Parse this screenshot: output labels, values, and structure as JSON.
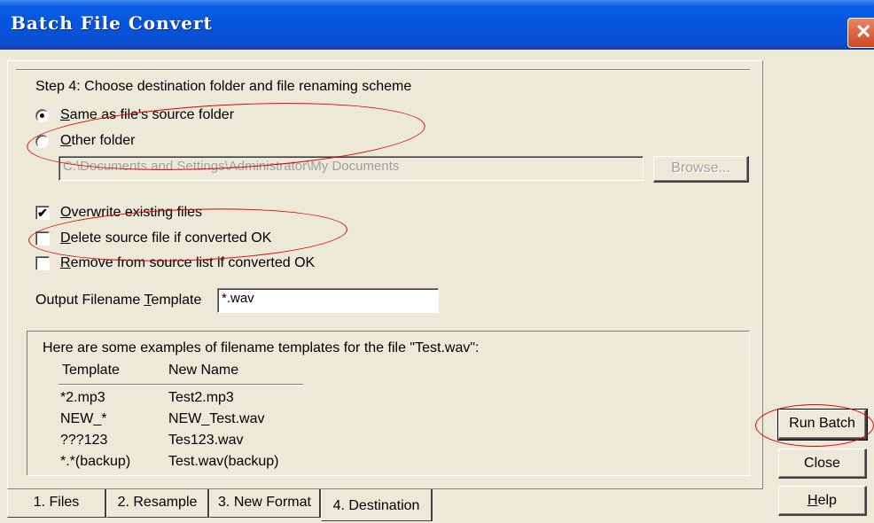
{
  "window": {
    "title": "Batch File Convert",
    "close_symbol": "✕"
  },
  "step_heading": "Step 4:  Choose destination folder and file renaming scheme",
  "folder_options": [
    {
      "label_access": "S",
      "label_rest": "ame as file's source folder",
      "selected": true
    },
    {
      "label_access": "O",
      "label_rest": "ther folder",
      "selected": false
    }
  ],
  "folder_path": "C:\\Documents and Settings\\Administrator\\My Documents",
  "browse_button": {
    "label": "Browse..."
  },
  "checkboxes": [
    {
      "label_access": "O",
      "label_rest": "verwrite existing files",
      "checked": true
    },
    {
      "label_access": "D",
      "label_rest": "elete source file if converted OK",
      "checked": false
    },
    {
      "label_access": "R",
      "label_rest": "emove from source list if converted OK",
      "checked": false
    }
  ],
  "output_template": {
    "label_pre": "Output Filename ",
    "label_access": "T",
    "label_post": "emplate",
    "value": "*.wav"
  },
  "examples": {
    "intro": "Here are some examples of filename templates for the file \"Test.wav\":",
    "col_template": "Template",
    "col_new_name": "New Name",
    "rows": [
      {
        "template": "*2.mp3",
        "new_name": "Test2.mp3"
      },
      {
        "template": "NEW_*",
        "new_name": "NEW_Test.wav"
      },
      {
        "template": "???123",
        "new_name": "Tes123.wav"
      },
      {
        "template": "*.*(backup)",
        "new_name": "Test.wav(backup)"
      }
    ]
  },
  "tabs": [
    {
      "label": "1. Files",
      "active": false
    },
    {
      "label": "2. Resample",
      "active": false
    },
    {
      "label": "3. New Format",
      "active": false
    },
    {
      "label": "4. Destination",
      "active": true
    }
  ],
  "side_buttons": {
    "run_batch": "Run Batch",
    "close": "Close",
    "help_access": "H",
    "help_rest": "elp"
  },
  "colors": {
    "title_bar": "#0854dc",
    "dialog_face": "#ece9d8",
    "annotation_red": "#e00000"
  }
}
